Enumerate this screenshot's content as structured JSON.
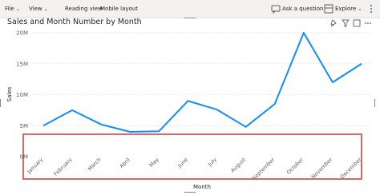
{
  "toolbar": {
    "file_label": "File",
    "view_label": "View",
    "reading_view_label": "Reading view",
    "mobile_layout_label": "Mobile layout",
    "ask_question_label": "Ask a question",
    "explore_label": "Explore"
  },
  "visual": {
    "title": "Sales and Month Number by Month"
  },
  "chart_data": {
    "type": "line",
    "title": "Sales and Month Number by Month",
    "xlabel": "Month",
    "ylabel": "Sales",
    "categories": [
      "January",
      "February",
      "March",
      "April",
      "May",
      "June",
      "July",
      "August",
      "September",
      "October",
      "November",
      "December"
    ],
    "series": [
      {
        "values": [
          5000000,
          7500000,
          5200000,
          4000000,
          4100000,
          9000000,
          7600000,
          4800000,
          8500000,
          20000000,
          12000000,
          15000000
        ]
      }
    ],
    "ylim": [
      0,
      20000000
    ],
    "yticks": [
      {
        "value": 0,
        "label": "0M"
      },
      {
        "value": 5000000,
        "label": "5M"
      },
      {
        "value": 10000000,
        "label": "10M"
      },
      {
        "value": 15000000,
        "label": "15M"
      },
      {
        "value": 20000000,
        "label": "20M"
      }
    ],
    "grid": true,
    "line_color": "#118dff",
    "highlight_color": "#d13438"
  }
}
